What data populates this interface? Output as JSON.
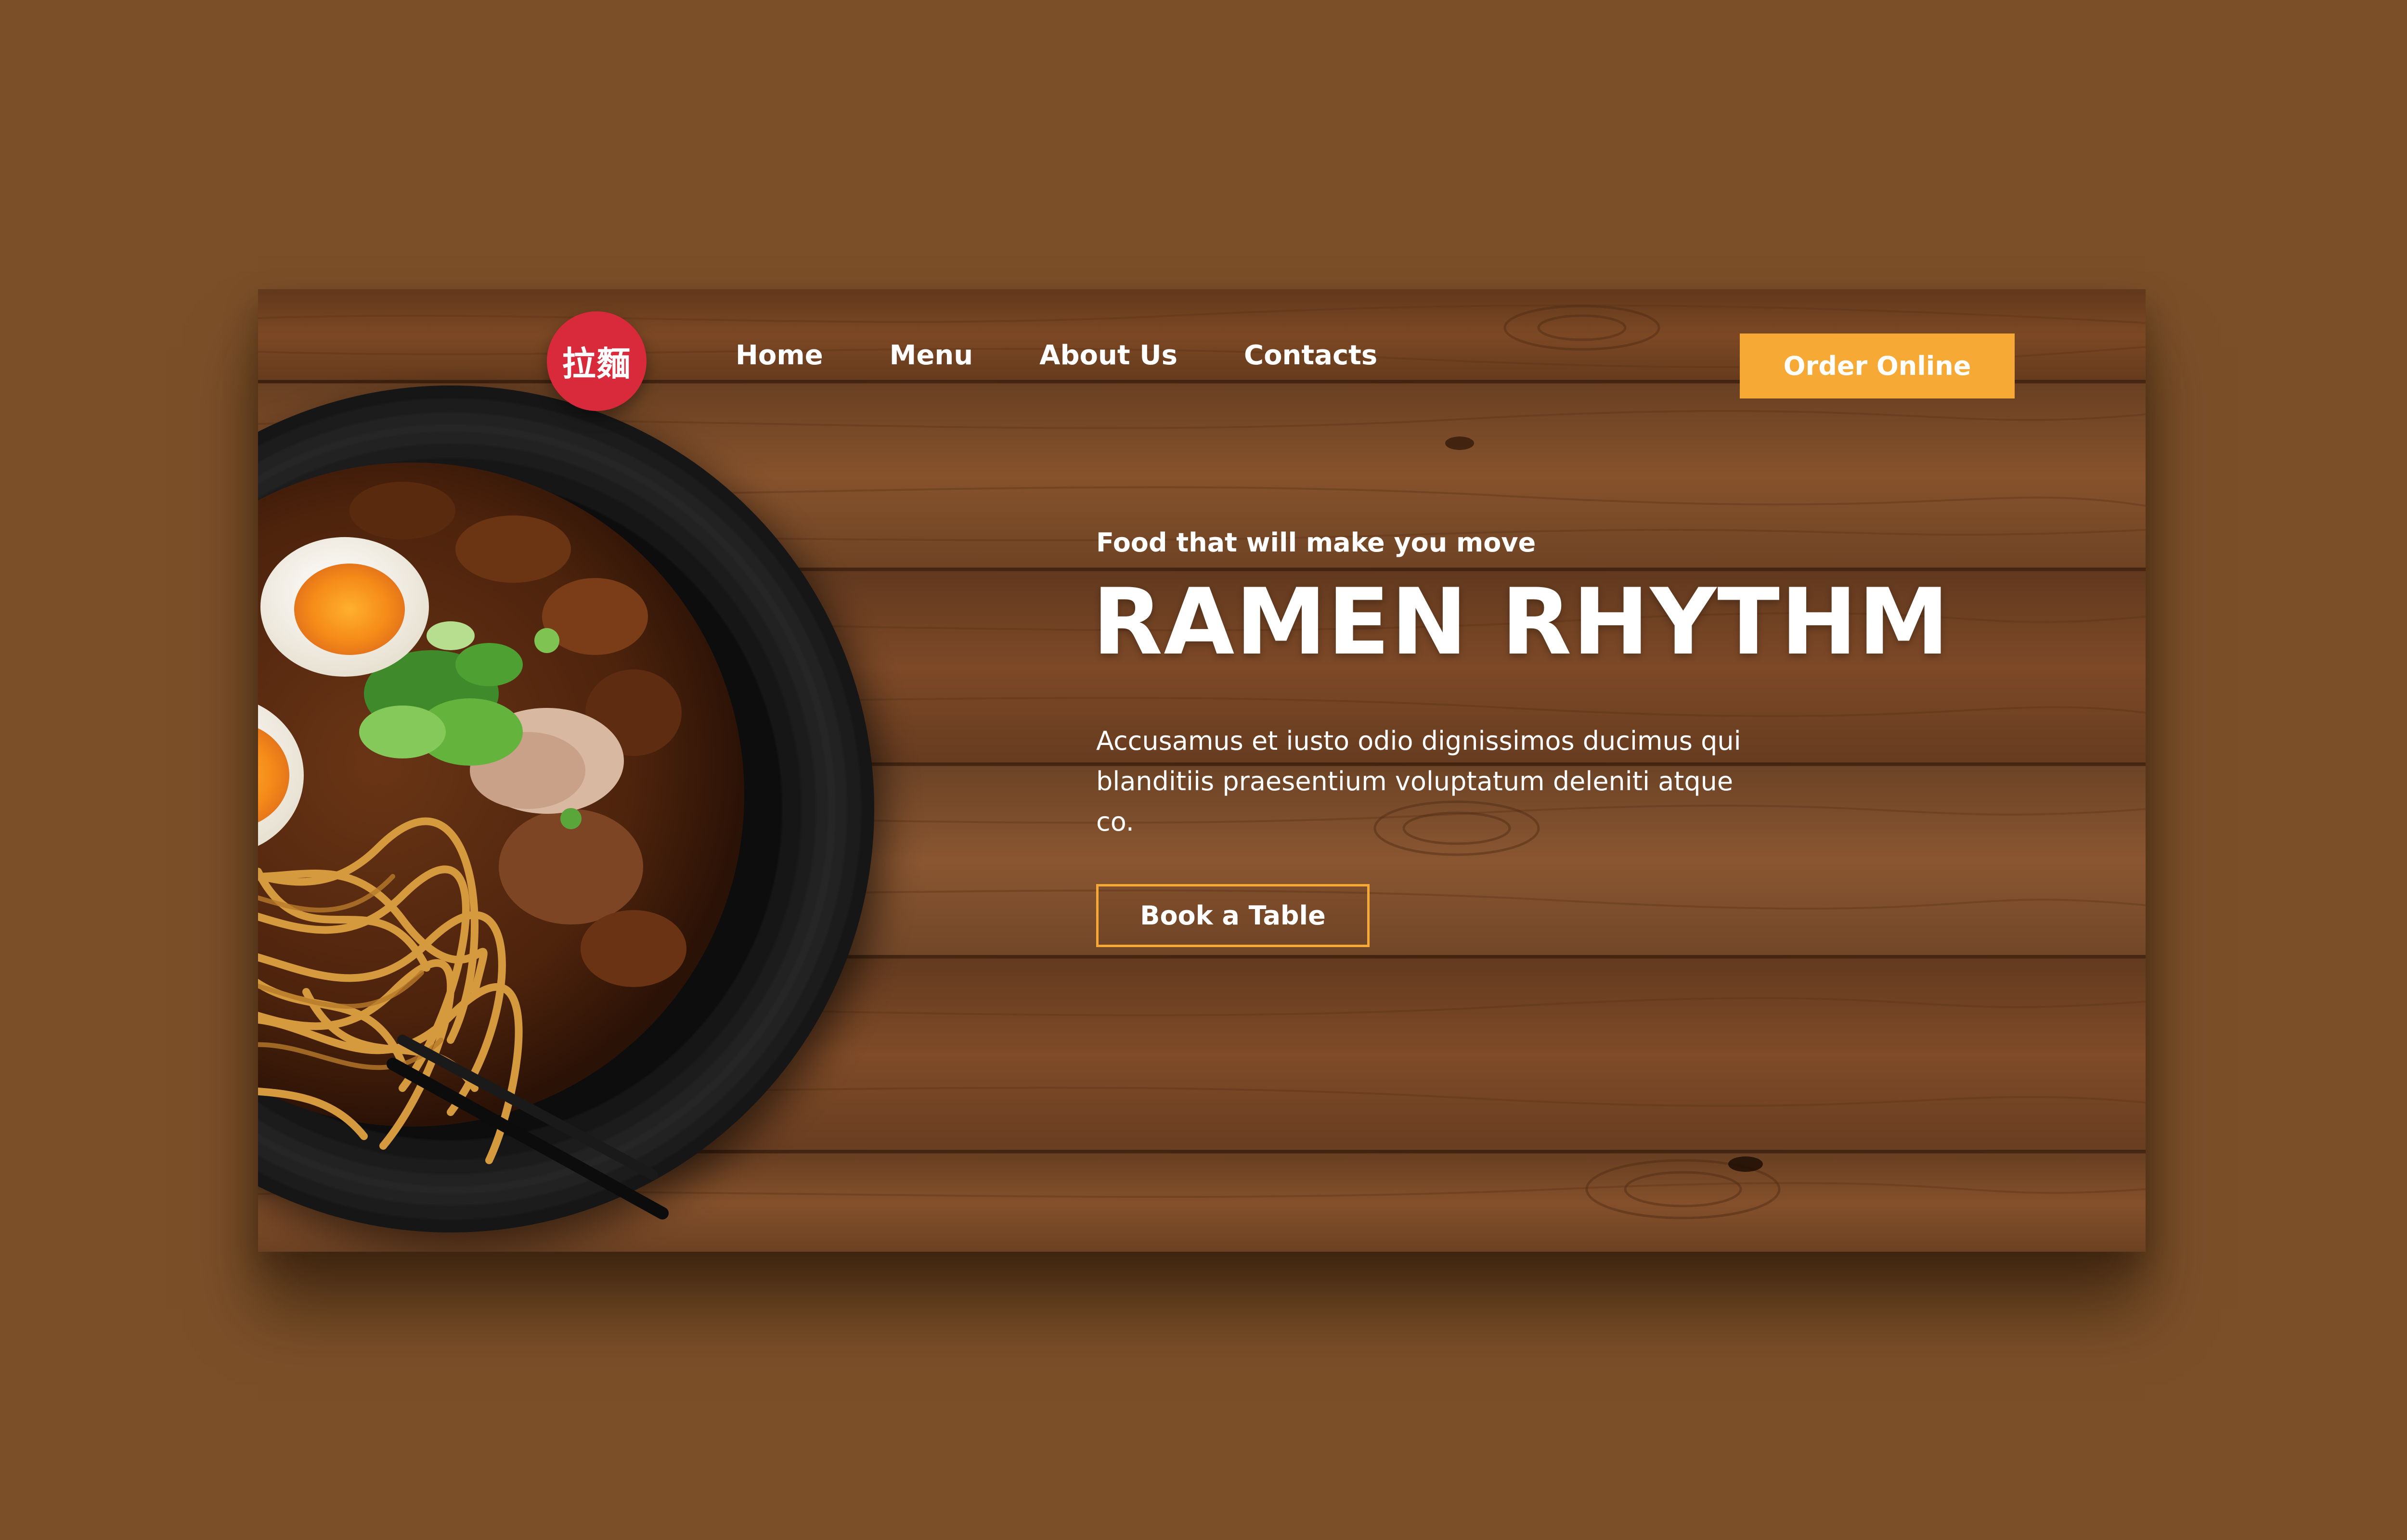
{
  "logo": {
    "text": "拉麵"
  },
  "nav": {
    "items": [
      {
        "label": "Home"
      },
      {
        "label": "Menu"
      },
      {
        "label": "About Us"
      },
      {
        "label": "Contacts"
      }
    ],
    "order_label": "Order Online"
  },
  "hero": {
    "tagline": "Food that will make you move",
    "title": "RAMEN RHYTHM",
    "description": "Accusamus et iusto odio dignissimos ducimus qui blanditiis praesentium voluptatum deleniti atque co.",
    "book_label": "Book a Table"
  },
  "colors": {
    "page_background": "#7b5029",
    "logo_red": "#d92a3c",
    "accent_orange": "#f6a935",
    "text": "#ffffff"
  },
  "icons": {
    "hero_image": "ramen-bowl-photo"
  }
}
